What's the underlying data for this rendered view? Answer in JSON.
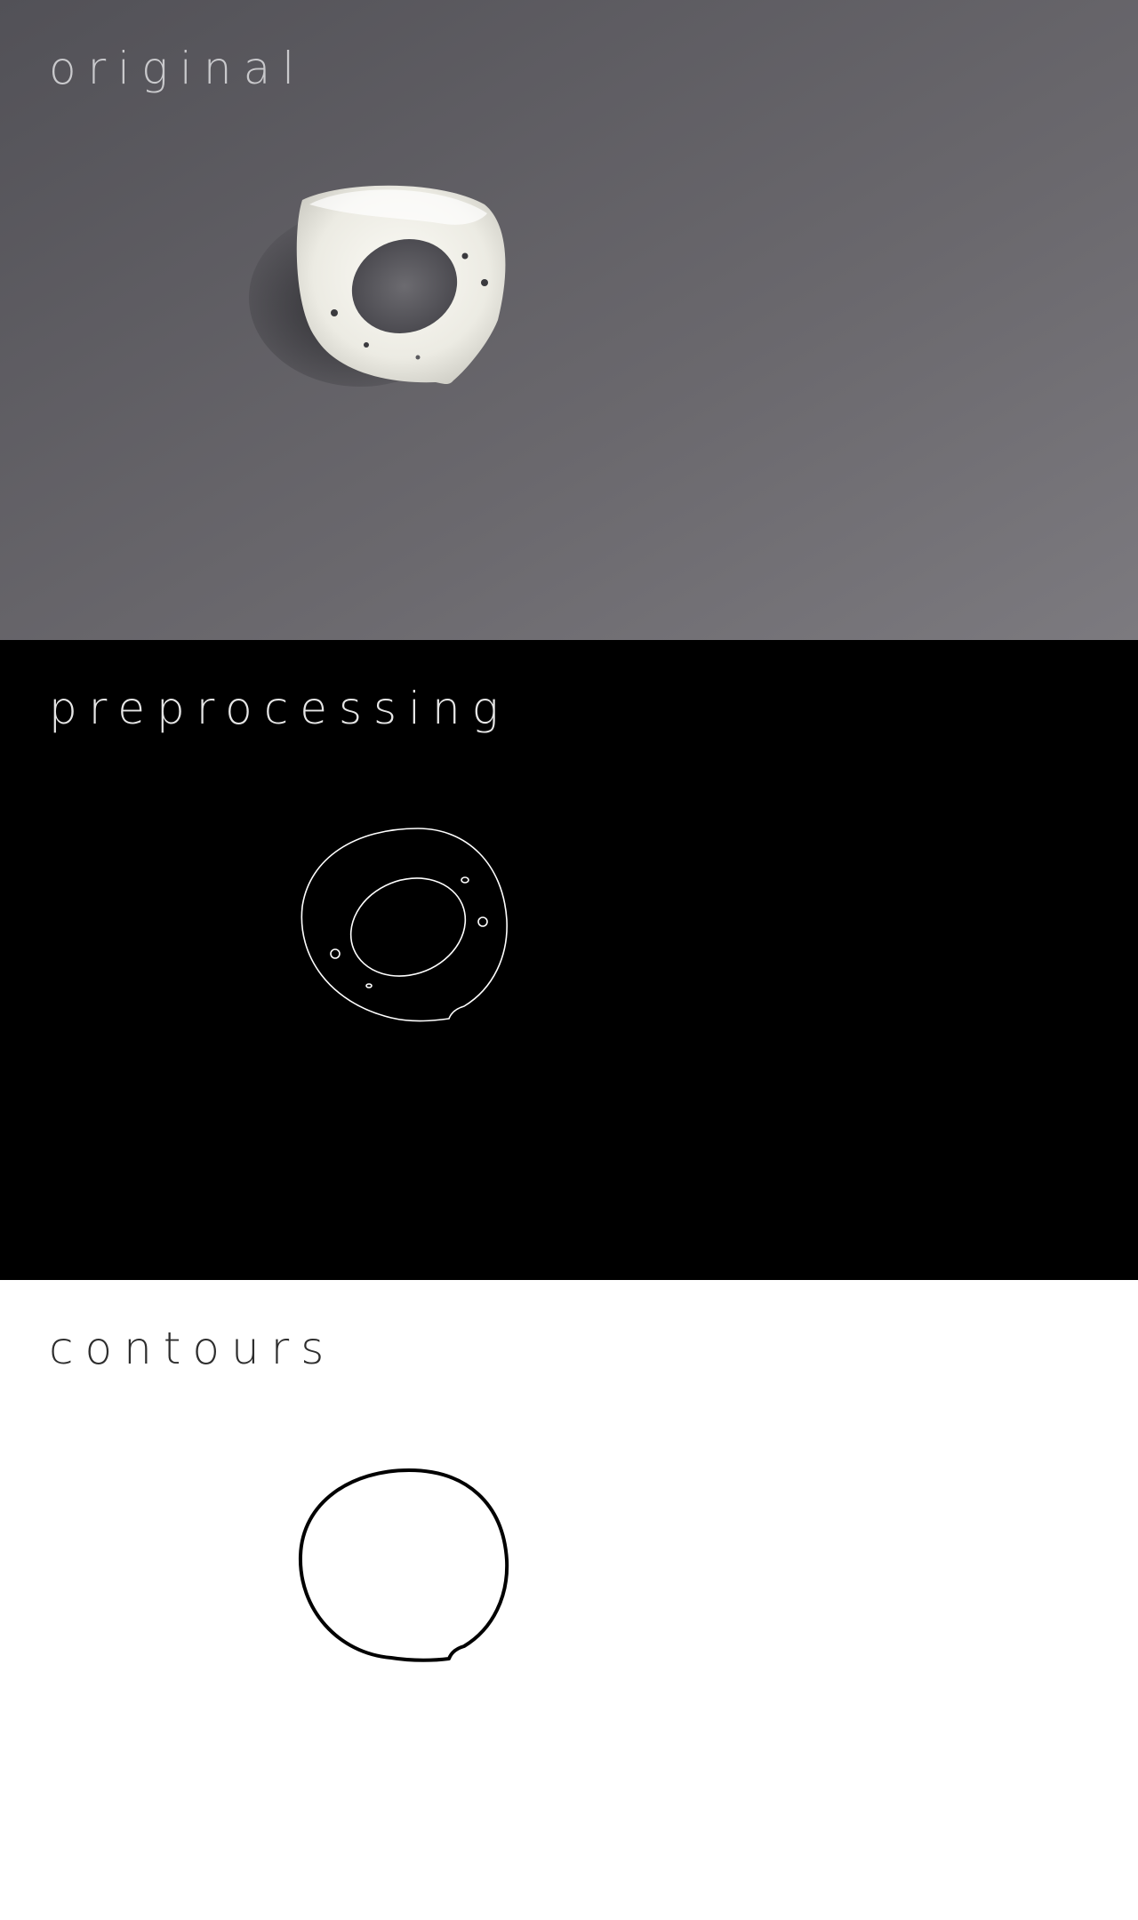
{
  "panels": {
    "original": {
      "label": "original",
      "background": "#5b5a5f",
      "subject": "white-ring-object"
    },
    "preprocessing": {
      "label": "preprocessing",
      "background": "#000000",
      "edge_color": "#ffffff"
    },
    "contours": {
      "label": "contours",
      "background": "#ffffff",
      "contour_color": "#000000"
    }
  }
}
